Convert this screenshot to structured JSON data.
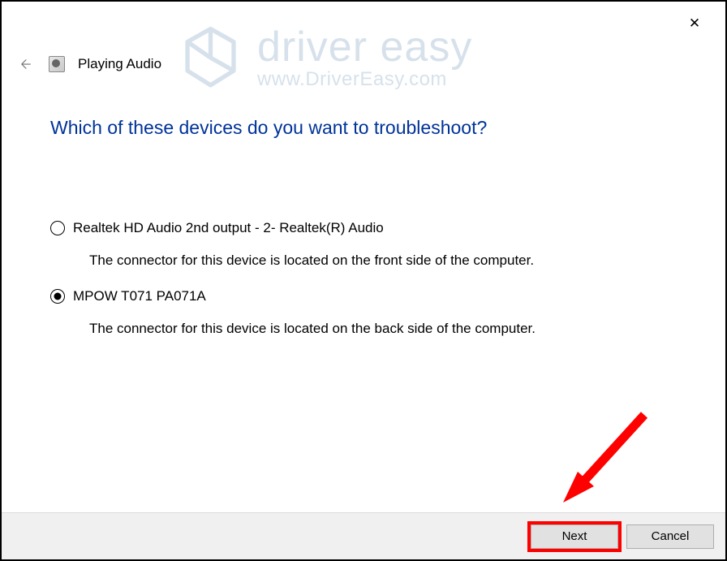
{
  "window": {
    "title": "Playing Audio"
  },
  "content": {
    "heading": "Which of these devices do you want to troubleshoot?",
    "devices": [
      {
        "label": "Realtek HD Audio 2nd output - 2- Realtek(R) Audio",
        "description": "The connector for this device is located on the front side of the computer.",
        "selected": false
      },
      {
        "label": "MPOW T071 PA071A",
        "description": "The connector for this device is located on the back side of the computer.",
        "selected": true
      }
    ]
  },
  "footer": {
    "next": "Next",
    "cancel": "Cancel"
  },
  "watermark": {
    "title": "driver easy",
    "url": "www.DriverEasy.com"
  }
}
